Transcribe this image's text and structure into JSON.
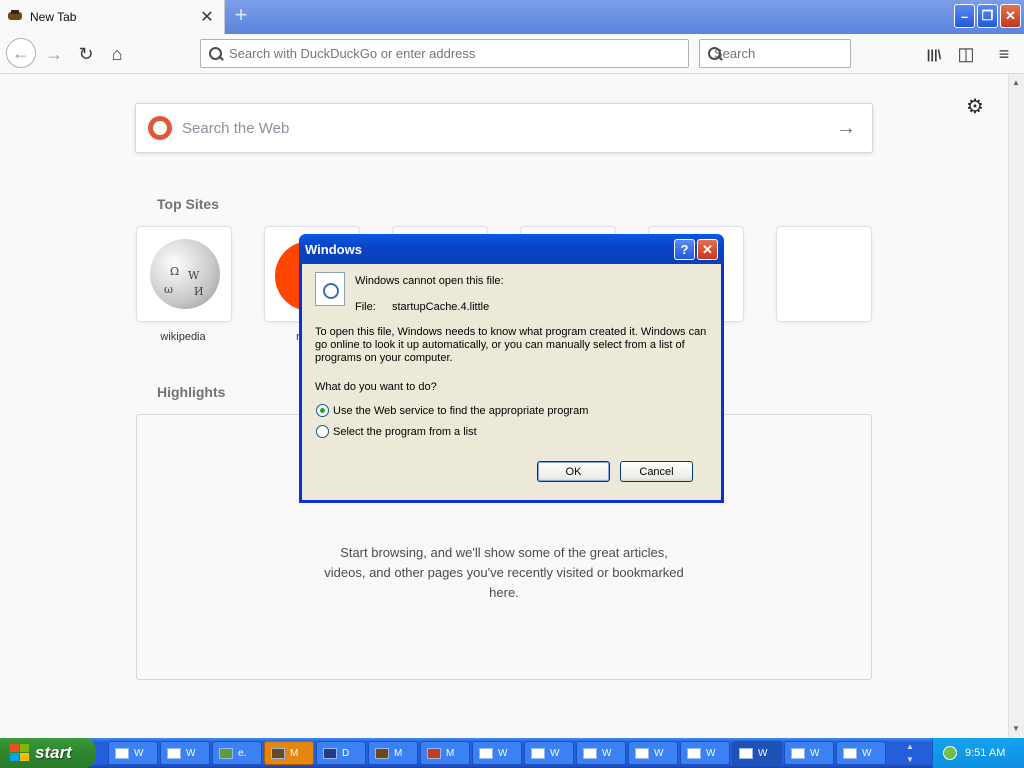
{
  "browser": {
    "tab": {
      "title": "New Tab",
      "close": "✕"
    },
    "new_tab": "+",
    "window_buttons": {
      "minimize": "–",
      "maximize": "❐",
      "close": "✕"
    },
    "nav": {
      "back": "←",
      "forward": "→",
      "reload": "↻",
      "home": "⌂"
    },
    "urlbar": {
      "placeholder": "Search with DuckDuckGo or enter address"
    },
    "searchbar": {
      "placeholder": "Search"
    },
    "toolbar": {
      "library": "|||\\",
      "sidebar": "◫",
      "menu": "≡"
    }
  },
  "newtab": {
    "settings_icon": "⚙",
    "web_search": {
      "placeholder": "Search the Web",
      "go": "→"
    },
    "top_sites": {
      "title": "Top Sites",
      "tiles": [
        {
          "label": "wikipedia"
        },
        {
          "label": "r"
        },
        {
          "label": ""
        },
        {
          "label": ""
        },
        {
          "label": ""
        },
        {
          "label": ""
        }
      ]
    },
    "highlights": {
      "title": "Highlights",
      "empty_message": "Start browsing, and we'll show some of the great articles, videos, and other pages you've recently visited or bookmarked here."
    }
  },
  "dialog": {
    "title": "Windows",
    "help": "?",
    "close": "✕",
    "cannot_open": "Windows cannot open this file:",
    "file_label": "File:",
    "file_name": "startupCache.4.little",
    "explanation": "To open this file, Windows needs to know what program created it.  Windows can go online to look it up automatically, or you can manually select from a list of programs on your computer.",
    "question": "What do you want to do?",
    "options": [
      {
        "label": "Use the Web service to find the appropriate program",
        "selected": true
      },
      {
        "label": "Select the program from a list",
        "selected": false
      }
    ],
    "ok": "OK",
    "cancel": "Cancel"
  },
  "taskbar": {
    "start": "start",
    "tasks": [
      {
        "label": "W"
      },
      {
        "label": "W"
      },
      {
        "label": "e."
      },
      {
        "label": "M"
      },
      {
        "label": "D"
      },
      {
        "label": "M"
      },
      {
        "label": "M"
      },
      {
        "label": "W"
      },
      {
        "label": "W"
      },
      {
        "label": "W"
      },
      {
        "label": "W"
      },
      {
        "label": "W"
      },
      {
        "label": "W"
      },
      {
        "label": "W"
      },
      {
        "label": "W"
      }
    ],
    "clock": "9:51 AM"
  },
  "colors": {
    "xp_blue": "#245edb",
    "dialog_title": "#0a5ae4",
    "dialog_face": "#ece9d8",
    "start_green": "#3c9a3c",
    "active_task_orange": "#e5870f"
  }
}
